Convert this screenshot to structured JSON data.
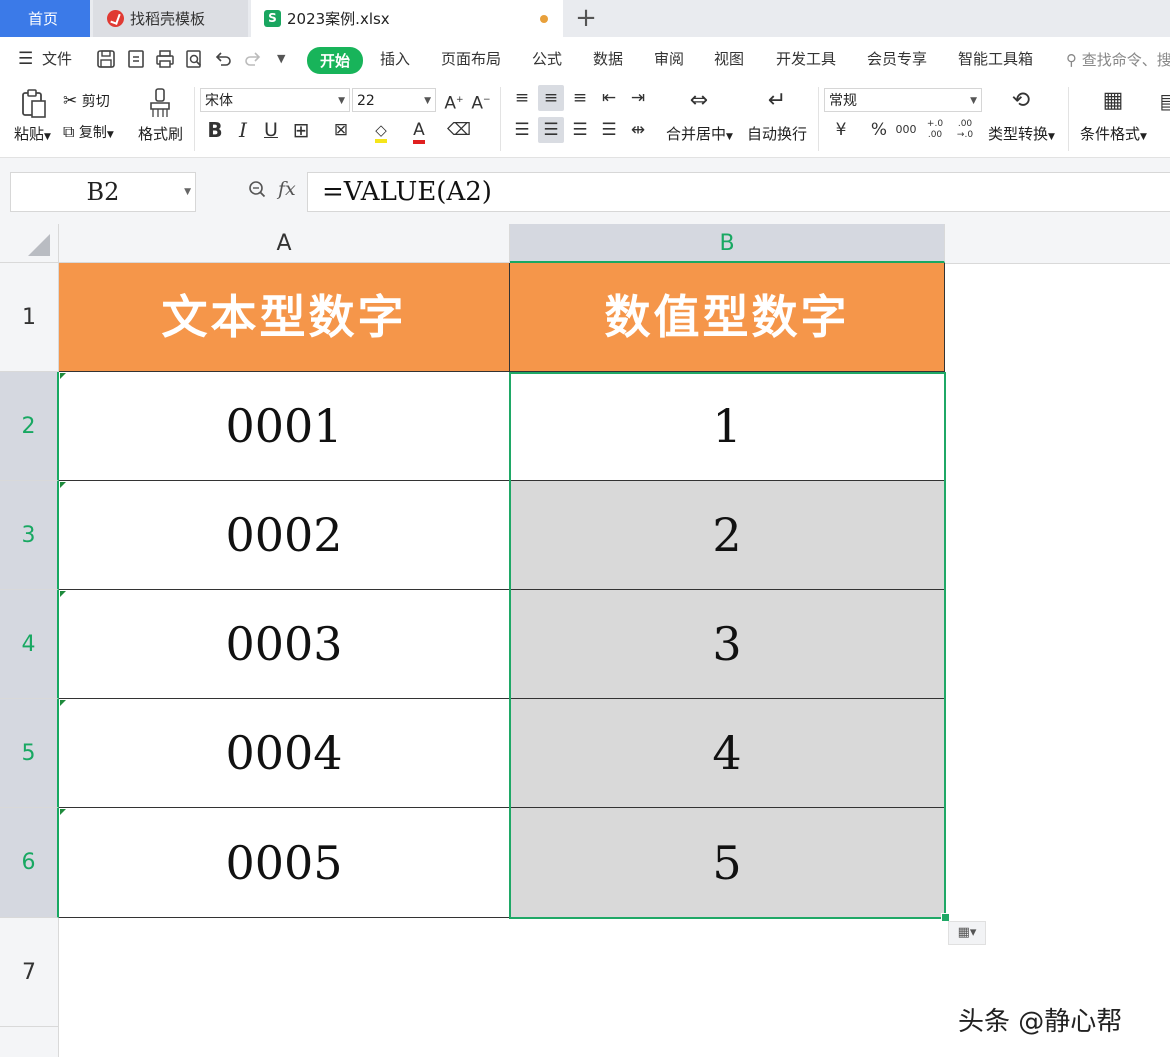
{
  "tabs": {
    "home": "首页",
    "template": "找稻壳模板",
    "file": "2023案例.xlsx",
    "sheet_icon_letter": "S"
  },
  "menu": {
    "file": "文件",
    "items": [
      "开始",
      "插入",
      "页面布局",
      "公式",
      "数据",
      "审阅",
      "视图",
      "开发工具",
      "会员专享",
      "智能工具箱"
    ],
    "search": "查找命令、搜"
  },
  "ribbon": {
    "paste": "粘贴",
    "cut": "剪切",
    "copy": "复制",
    "format_painter": "格式刷",
    "font_name": "宋体",
    "font_size": "22",
    "merge_center": "合并居中",
    "wrap_text": "自动换行",
    "number_format": "常规",
    "type_convert": "类型转换",
    "conditional_format": "条件格式",
    "currency_symbol": "¥",
    "percent_symbol": "%",
    "thousands_symbol": "000",
    "inc_decimal": "+.0 .00",
    "dec_decimal": ".00 →.0"
  },
  "formula_bar": {
    "name_box": "B2",
    "fx": "fx",
    "formula": "=VALUE(A2)"
  },
  "grid": {
    "columns": [
      "A",
      "B"
    ],
    "rows": [
      "1",
      "2",
      "3",
      "4",
      "5",
      "6",
      "7"
    ],
    "header": [
      "文本型数字",
      "数值型数字"
    ],
    "col_a": [
      "0001",
      "0002",
      "0003",
      "0004",
      "0005"
    ],
    "col_b": [
      "1",
      "2",
      "3",
      "4",
      "5"
    ]
  },
  "colors": {
    "header_fill": "#f5964a",
    "selection": "#1fa866",
    "selected_fill": "#d9d9d9",
    "start_tab": "#18b45a",
    "home_tab": "#3b7ae8"
  },
  "watermark": "头条 @静心帮"
}
